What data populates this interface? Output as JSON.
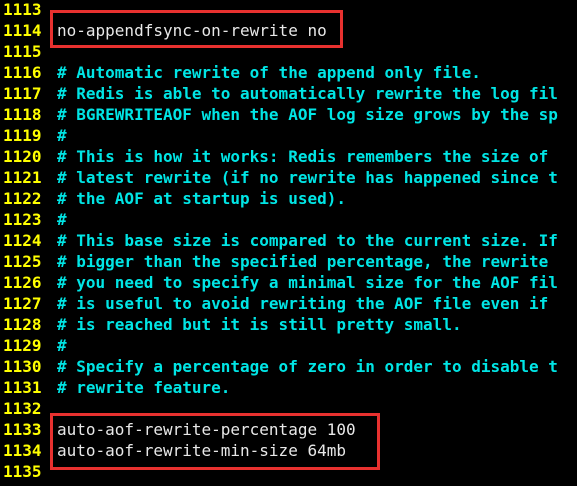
{
  "editor": {
    "lines": [
      {
        "num": "1113",
        "text": "",
        "kind": "blank"
      },
      {
        "num": "1114",
        "text": "no-appendfsync-on-rewrite no",
        "kind": "config"
      },
      {
        "num": "1115",
        "text": "",
        "kind": "blank"
      },
      {
        "num": "1116",
        "text": "# Automatic rewrite of the append only file.",
        "kind": "comment"
      },
      {
        "num": "1117",
        "text": "# Redis is able to automatically rewrite the log fil",
        "kind": "comment"
      },
      {
        "num": "1118",
        "text": "# BGREWRITEAOF when the AOF log size grows by the sp",
        "kind": "comment"
      },
      {
        "num": "1119",
        "text": "#",
        "kind": "comment"
      },
      {
        "num": "1120",
        "text": "# This is how it works: Redis remembers the size of",
        "kind": "comment"
      },
      {
        "num": "1121",
        "text": "# latest rewrite (if no rewrite has happened since t",
        "kind": "comment"
      },
      {
        "num": "1122",
        "text": "# the AOF at startup is used).",
        "kind": "comment"
      },
      {
        "num": "1123",
        "text": "#",
        "kind": "comment"
      },
      {
        "num": "1124",
        "text": "# This base size is compared to the current size. If",
        "kind": "comment"
      },
      {
        "num": "1125",
        "text": "# bigger than the specified percentage, the rewrite",
        "kind": "comment"
      },
      {
        "num": "1126",
        "text": "# you need to specify a minimal size for the AOF fil",
        "kind": "comment"
      },
      {
        "num": "1127",
        "text": "# is useful to avoid rewriting the AOF file even if",
        "kind": "comment"
      },
      {
        "num": "1128",
        "text": "# is reached but it is still pretty small.",
        "kind": "comment"
      },
      {
        "num": "1129",
        "text": "#",
        "kind": "comment"
      },
      {
        "num": "1130",
        "text": "# Specify a percentage of zero in order to disable t",
        "kind": "comment"
      },
      {
        "num": "1131",
        "text": "# rewrite feature.",
        "kind": "comment"
      },
      {
        "num": "1132",
        "text": "",
        "kind": "blank"
      },
      {
        "num": "1133",
        "text": "auto-aof-rewrite-percentage 100",
        "kind": "config"
      },
      {
        "num": "1134",
        "text": "auto-aof-rewrite-min-size 64mb",
        "kind": "config"
      },
      {
        "num": "1135",
        "text": "",
        "kind": "blank"
      }
    ]
  },
  "colors": {
    "background": "#000000",
    "line_number": "#ffff00",
    "comment": "#00e5e5",
    "config": "#e8e8e8",
    "highlight_border": "#e8312f"
  }
}
